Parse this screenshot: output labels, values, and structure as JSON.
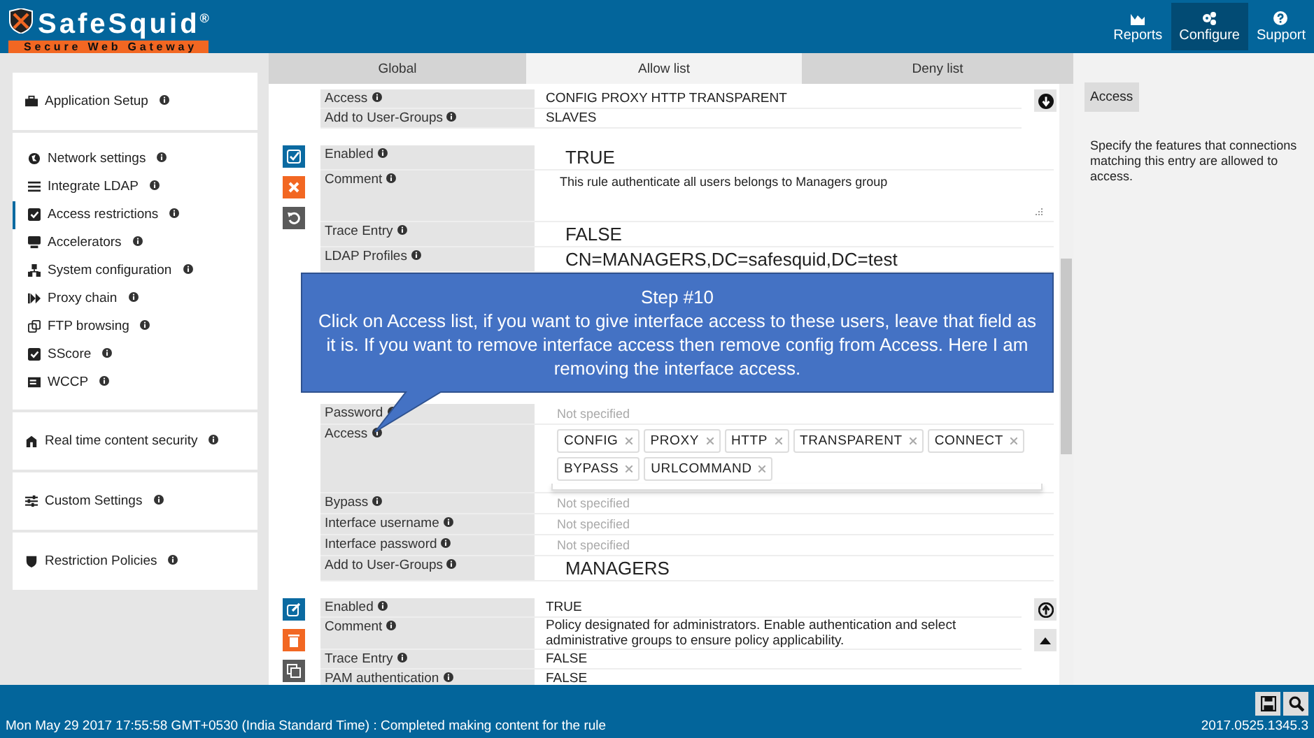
{
  "header": {
    "logo": {
      "name": "SafeSquid$^{®}$",
      "tagline": "Secure Web Gateway"
    },
    "nav": [
      {
        "label": "Reports",
        "selected": false
      },
      {
        "label": "Configure",
        "selected": true
      },
      {
        "label": "Support",
        "selected": false
      }
    ]
  },
  "sidebar": {
    "groups": [
      {
        "items": [
          {
            "label": "Application Setup",
            "selected": false
          }
        ]
      },
      {
        "items": [
          {
            "label": "Network settings",
            "selected": false
          },
          {
            "label": "Integrate LDAP",
            "selected": false
          },
          {
            "label": "Access restrictions",
            "selected": true
          },
          {
            "label": "Accelerators",
            "selected": false
          },
          {
            "label": "System configuration",
            "selected": false
          },
          {
            "label": "Proxy chain",
            "selected": false
          },
          {
            "label": "FTP browsing",
            "selected": false
          },
          {
            "label": "SScore",
            "selected": false
          },
          {
            "label": "WCCP",
            "selected": false
          }
        ]
      },
      {
        "items": [
          {
            "label": "Real time content security",
            "selected": false
          }
        ]
      },
      {
        "items": [
          {
            "label": "Custom Settings",
            "selected": false
          }
        ]
      },
      {
        "items": [
          {
            "label": "Restriction Policies",
            "selected": false
          }
        ]
      }
    ]
  },
  "tabs": [
    {
      "label": "Global",
      "selected": false
    },
    {
      "label": "Allow list",
      "selected": true
    },
    {
      "label": "Deny list",
      "selected": false
    }
  ],
  "previous_entry": {
    "rows": [
      {
        "label": "Access",
        "kind": "value",
        "value": "CONFIG  PROXY  HTTP  TRANSPARENT"
      },
      {
        "label": "Add to User-Groups",
        "kind": "value",
        "value": "SLAVES"
      }
    ]
  },
  "editing_entry": {
    "rows": [
      {
        "label": "Enabled",
        "kind": "large",
        "value": "TRUE"
      },
      {
        "label": "Comment",
        "kind": "textarea",
        "value": "This rule authenticate all users belongs to Managers group"
      },
      {
        "label": "Trace Entry",
        "kind": "large",
        "value": "FALSE"
      },
      {
        "label": "LDAP Profiles",
        "kind": "large",
        "value": "CN=MANAGERS,DC=safesquid,DC=test"
      }
    ],
    "callout": {
      "title": "Step #10",
      "text": "Click on Access list, if you want to give interface access to these users, leave that field as it is.  If you want to remove interface access then remove config from Access. Here I am removing the interface access."
    },
    "rows_continued": [
      {
        "label": "Password",
        "kind": "placeholder",
        "placeholder": "Not specified"
      },
      {
        "label": "Access",
        "kind": "tags",
        "tags": [
          "CONFIG",
          "PROXY",
          "HTTP",
          "TRANSPARENT",
          "CONNECT",
          "BYPASS",
          "URLCOMMAND"
        ]
      },
      {
        "label": "Bypass",
        "kind": "placeholder",
        "placeholder": "Not specified"
      },
      {
        "label": "Interface username",
        "kind": "placeholder",
        "placeholder": "Not specified"
      },
      {
        "label": "Interface password",
        "kind": "placeholder",
        "placeholder": "Not specified"
      },
      {
        "label": "Add to User-Groups",
        "kind": "large",
        "value": "MANAGERS"
      }
    ]
  },
  "next_entry": {
    "rows": [
      {
        "label": "Enabled",
        "kind": "value",
        "value": "TRUE"
      },
      {
        "label": "Comment",
        "kind": "value",
        "value": "Policy designated for administrators. Enable authentication and select administrative groups to ensure policy applicability."
      },
      {
        "label": "Trace Entry",
        "kind": "value",
        "value": "FALSE"
      },
      {
        "label": "PAM authentication",
        "kind": "value",
        "value": "FALSE"
      }
    ]
  },
  "help": {
    "title": "Access",
    "text": "Specify the features that connections matching this entry are allowed to access."
  },
  "status_bar": {
    "message": "Mon May 29 2017 17:55:58 GMT+0530 (India Standard Time) : Completed making content for the rule",
    "version": "2017.0525.1345.3"
  }
}
